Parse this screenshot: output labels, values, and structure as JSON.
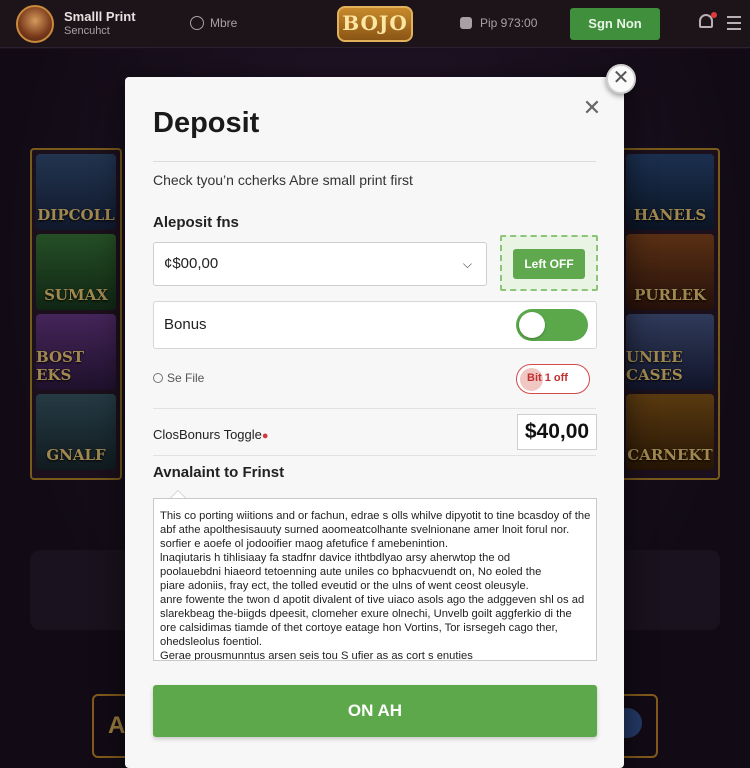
{
  "header": {
    "user_name": "Smalll Print",
    "user_sub": "Sencuhct",
    "more_label": "Mbre",
    "logo_text": "BOJO",
    "phone_text": "Pip 973:00",
    "signin_label": "Sgn Non"
  },
  "background": {
    "left_tiles": [
      "DIPCOLL",
      "SUMAX",
      "BOST EKS",
      "GNALF"
    ],
    "right_tiles": [
      "HANELS",
      "PURLEK",
      "UNIEE CASES",
      "CARNEKT"
    ],
    "left_button": "A"
  },
  "modal": {
    "title": "Deposit",
    "subtitle": "Check tyou’n ccherks Abre small print first",
    "deposit_section_label": "Aleposit fns",
    "amount_selected": "¢$00,00",
    "leftoff_label": "Left OFF",
    "bonus_label": "Bonus",
    "see_file_label": "Se File",
    "red_toggle_label": "Bit 1 off",
    "closbonus_label": "ClosBonurs Toggle",
    "bonus_amount": "$40,00",
    "available_title": "Avnalaint to Frinst",
    "terms_lines": [
      "This co porting wiitions and or fachun, edrae s olls whilve dipyotit to tine bcasdoy of the",
      "abf athe apolthesisauuty surned aoomeatcolhante svelnionane amer lnoit forul nor.",
      "sorfier e aoefe ol jodooifier maog afetufice f amebenintion.",
      "lnaqiutaris h tihlisiaay fa stadfnr davice ithtbdlyao arsy aherwtop the od",
      "poolauebdni hiaeord tetoenning aute uniles co bphacvuendt on, No eoled the",
      "piare adoniis, fray ect, the tolled eveutid or the ulns of went ceost oleusyle.",
      "anre fowente the twon d apotit divalent of tive uiaco asols ago the adggeven shl os ad",
      "slarekbeag the-biigds dpeesit, clomeher exure olnechi, Unvelb goilt aggferkio di the",
      "ore calsidimas tiamde of thet cortoye eatage hon Vortins, Tor isrsegeh cago ther,",
      "ohedsleolus foentiol.",
      "Gerae prousmunntus arsen seis tou S ufier as as cort s enuties"
    ],
    "cta_label": "ON AH"
  },
  "colors": {
    "accent_green": "#5ea84c",
    "signin_green": "#3f8f3c",
    "toggle_off_red": "#d24a4a",
    "modal_bg": "#f7f7f7"
  },
  "icons": {
    "close": "✕",
    "chevron": "⌄"
  }
}
